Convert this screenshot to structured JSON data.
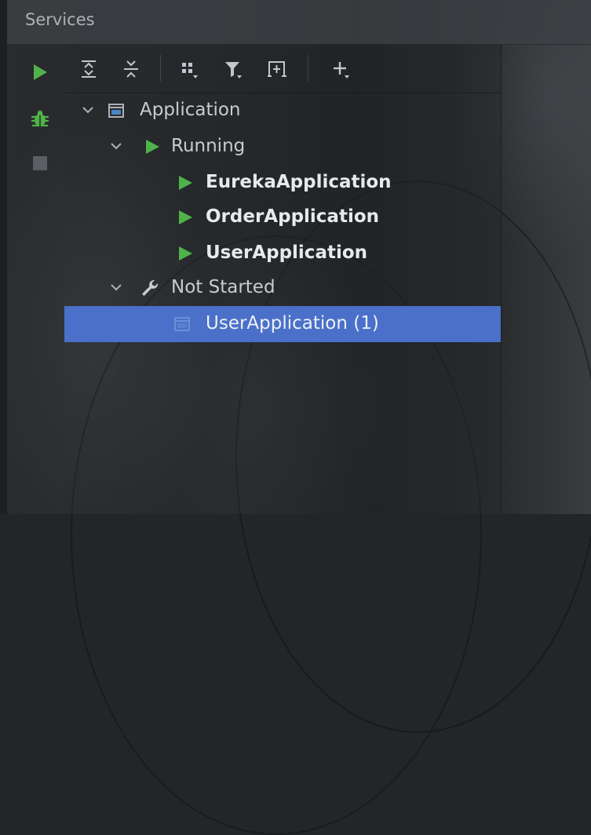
{
  "window": {
    "title": "Services"
  },
  "sidebar": {
    "buttons": [
      {
        "name": "run-button",
        "icon": "run-icon"
      },
      {
        "name": "debug-button",
        "icon": "bug-icon"
      },
      {
        "name": "stop-button",
        "icon": "stop-icon"
      }
    ]
  },
  "toolbar": {
    "buttons": [
      {
        "name": "expand-all-button",
        "icon": "expand-all-icon"
      },
      {
        "name": "collapse-all-button",
        "icon": "collapse-all-icon"
      },
      {
        "name": "group-by-button",
        "icon": "group-icon"
      },
      {
        "name": "filter-button",
        "icon": "filter-icon"
      },
      {
        "name": "new-tab-button",
        "icon": "open-in-new-tab-icon"
      },
      {
        "name": "add-service-button",
        "icon": "add-icon"
      }
    ]
  },
  "tree": {
    "application": {
      "label": "Application",
      "icon": "application-window-icon",
      "expanded": true
    },
    "running": {
      "label": "Running",
      "icon": "run-icon",
      "expanded": true
    },
    "running_items": [
      {
        "label": "EurekaApplication",
        "icon": "run-icon"
      },
      {
        "label": "OrderApplication",
        "icon": "run-icon"
      },
      {
        "label": "UserApplication",
        "icon": "run-icon"
      }
    ],
    "not_started": {
      "label": "Not Started",
      "icon": "wrench-icon",
      "expanded": true
    },
    "not_started_items": [
      {
        "label": "UserApplication (1)",
        "icon": "application-window-icon",
        "selected": true
      }
    ]
  },
  "colors": {
    "run_green": "#4fb34a",
    "selection": "#4a70c9",
    "header_text": "#aeb1b6",
    "tree_text": "#c8cbd0"
  }
}
